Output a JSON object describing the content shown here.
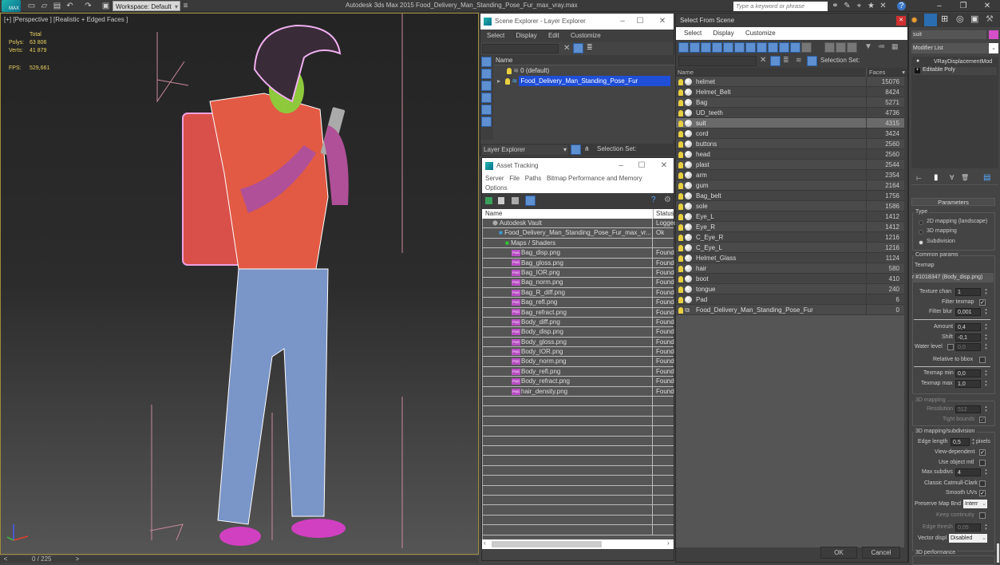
{
  "titlebar": {
    "app_logo": "MAX",
    "workspace": "Workspace: Default",
    "title": "Autodesk 3ds Max  2015    Food_Delivery_Man_Standing_Pose_Fur_max_vray.max",
    "search_placeholder": "Type a keyword or phrase"
  },
  "viewport": {
    "label": "[+] [Perspective ] [Realistic + Edged Faces ]",
    "stats": {
      "header": "Total",
      "polys_label": "Polys:",
      "polys_value": "63 806",
      "verts_label": "Verts:",
      "verts_value": "41 879",
      "fps_label": "FPS:",
      "fps_value": "529,661"
    }
  },
  "timeline": {
    "prev": "<",
    "next": ">",
    "frame": "0 / 225"
  },
  "scene_explorer": {
    "title": "Scene Explorer - Layer Explorer",
    "menu": [
      "Select",
      "Display",
      "Edit",
      "Customize"
    ],
    "column_name": "Name",
    "rows": [
      {
        "label": "0 (default)",
        "selected": false
      },
      {
        "label": "Food_Delivery_Man_Standing_Pose_Fur",
        "selected": true
      }
    ],
    "footer_dropdown": "Layer Explorer",
    "footer_selection_set": "Selection Set:"
  },
  "asset_tracking": {
    "title": "Asset Tracking",
    "menu": [
      "Server",
      "File",
      "Paths",
      "Bitmap Performance and Memory",
      "Options"
    ],
    "columns": {
      "name": "Name",
      "status": "Status"
    },
    "rows": [
      {
        "name": "Autodesk Vault",
        "status": "Logged",
        "indent": 1,
        "type": "vault"
      },
      {
        "name": "Food_Delivery_Man_Standing_Pose_Fur_max_vr...",
        "status": "Ok",
        "indent": 2,
        "type": "max"
      },
      {
        "name": "Maps / Shaders",
        "status": "",
        "indent": 3,
        "type": "maps"
      },
      {
        "name": "Bag_disp.png",
        "status": "Found",
        "indent": 4,
        "type": "png"
      },
      {
        "name": "Bag_gloss.png",
        "status": "Found",
        "indent": 4,
        "type": "png"
      },
      {
        "name": "Bag_IOR.png",
        "status": "Found",
        "indent": 4,
        "type": "png"
      },
      {
        "name": "Bag_norm.png",
        "status": "Found",
        "indent": 4,
        "type": "png"
      },
      {
        "name": "Bag_R_diff.png",
        "status": "Found",
        "indent": 4,
        "type": "png"
      },
      {
        "name": "Bag_refl.png",
        "status": "Found",
        "indent": 4,
        "type": "png"
      },
      {
        "name": "Bag_refract.png",
        "status": "Found",
        "indent": 4,
        "type": "png"
      },
      {
        "name": "Body_diff.png",
        "status": "Found",
        "indent": 4,
        "type": "png"
      },
      {
        "name": "Body_disp.png",
        "status": "Found",
        "indent": 4,
        "type": "png"
      },
      {
        "name": "Body_gloss.png",
        "status": "Found",
        "indent": 4,
        "type": "png"
      },
      {
        "name": "Body_IOR.png",
        "status": "Found",
        "indent": 4,
        "type": "png"
      },
      {
        "name": "Body_norm.png",
        "status": "Found",
        "indent": 4,
        "type": "png"
      },
      {
        "name": "Body_refl.png",
        "status": "Found",
        "indent": 4,
        "type": "png"
      },
      {
        "name": "Body_refract.png",
        "status": "Found",
        "indent": 4,
        "type": "png"
      },
      {
        "name": "hair_density.png",
        "status": "Found",
        "indent": 4,
        "type": "png"
      }
    ]
  },
  "select_from_scene": {
    "title": "Select From Scene",
    "menu": [
      "Select",
      "Display",
      "Customize"
    ],
    "selection_set": "Selection Set:",
    "columns": {
      "name": "Name",
      "faces": "Faces"
    },
    "rows": [
      {
        "name": "helmet",
        "faces": "15076"
      },
      {
        "name": "Helmet_Belt",
        "faces": "8424"
      },
      {
        "name": "Bag",
        "faces": "5271"
      },
      {
        "name": "UD_teeth",
        "faces": "4736"
      },
      {
        "name": "suit",
        "faces": "4315",
        "selected": true
      },
      {
        "name": "cord",
        "faces": "3424"
      },
      {
        "name": "buttons",
        "faces": "2560"
      },
      {
        "name": "head",
        "faces": "2560"
      },
      {
        "name": "plast",
        "faces": "2544"
      },
      {
        "name": "arm",
        "faces": "2354"
      },
      {
        "name": "gum",
        "faces": "2164"
      },
      {
        "name": "Bag_belt",
        "faces": "1756"
      },
      {
        "name": "sole",
        "faces": "1586"
      },
      {
        "name": "Eye_L",
        "faces": "1412"
      },
      {
        "name": "Eye_R",
        "faces": "1412"
      },
      {
        "name": "C_Eye_R",
        "faces": "1216"
      },
      {
        "name": "C_Eye_L",
        "faces": "1216"
      },
      {
        "name": "Helmet_Glass",
        "faces": "1124"
      },
      {
        "name": "hair",
        "faces": "580"
      },
      {
        "name": "boot",
        "faces": "410"
      },
      {
        "name": "tongue",
        "faces": "240"
      },
      {
        "name": "Pad",
        "faces": "6"
      },
      {
        "name": "Food_Delivery_Man_Standing_Pose_Fur",
        "faces": "0",
        "group": true
      }
    ],
    "ok": "OK",
    "cancel": "Cancel"
  },
  "command_panel": {
    "object_name": "suit",
    "object_color": "#d54fc8",
    "modifier_list": "Modifier List",
    "stack": [
      "VRayDisplacementMod",
      "Editable Poly"
    ],
    "rollout_title": "Parameters",
    "type_group": "Type",
    "type_options": [
      {
        "label": "2D mapping (landscape)",
        "checked": false
      },
      {
        "label": "3D mapping",
        "checked": false
      },
      {
        "label": "Subdivision",
        "checked": true
      }
    ],
    "common_group": "Common params",
    "texmap_label": "Texmap",
    "texmap_value": "r #1018347 (Body_disp.png)",
    "texture_chan_label": "Texture chan",
    "texture_chan": "1",
    "filter_texmap_label": "Filter texmap",
    "filter_texmap": true,
    "filter_blur_label": "Filter blur",
    "filter_blur": "0,001",
    "amount_label": "Amount",
    "amount": "0,4",
    "shift_label": "Shift",
    "shift": "-0,1",
    "water_level_label": "Water level",
    "water_level": "0,0",
    "relative_bbox_label": "Relative to bbox",
    "texmap_min_label": "Texmap min",
    "texmap_min": "0,0",
    "texmap_max_label": "Texmap max",
    "texmap_max": "1,0",
    "mapping3d_group": "3D mapping",
    "resolution_label": "Resolution",
    "resolution": "512",
    "tight_bounds_label": "Tight bounds",
    "subdiv_group": "3D mapping/subdivision",
    "edge_length_label": "Edge length",
    "edge_length": "0,5",
    "pixels_label": "pixels",
    "view_dependent_label": "View-dependent",
    "use_object_mtl_label": "Use object mtl",
    "max_subdivs_label": "Max subdivs",
    "max_subdivs": "4",
    "classic_cc_label": "Classic Catmull-Clark",
    "smooth_uvs_label": "Smooth UVs",
    "preserve_map_label": "Preserve Map Bnd",
    "preserve_map_value": "Interr",
    "keep_continuity_label": "Keep continuity",
    "edge_thresh_label": "Edge thresh",
    "edge_thresh": "0,05",
    "vector_displ_label": "Vector displ",
    "vector_displ_value": "Disabled",
    "performance_group": "3D performance"
  }
}
